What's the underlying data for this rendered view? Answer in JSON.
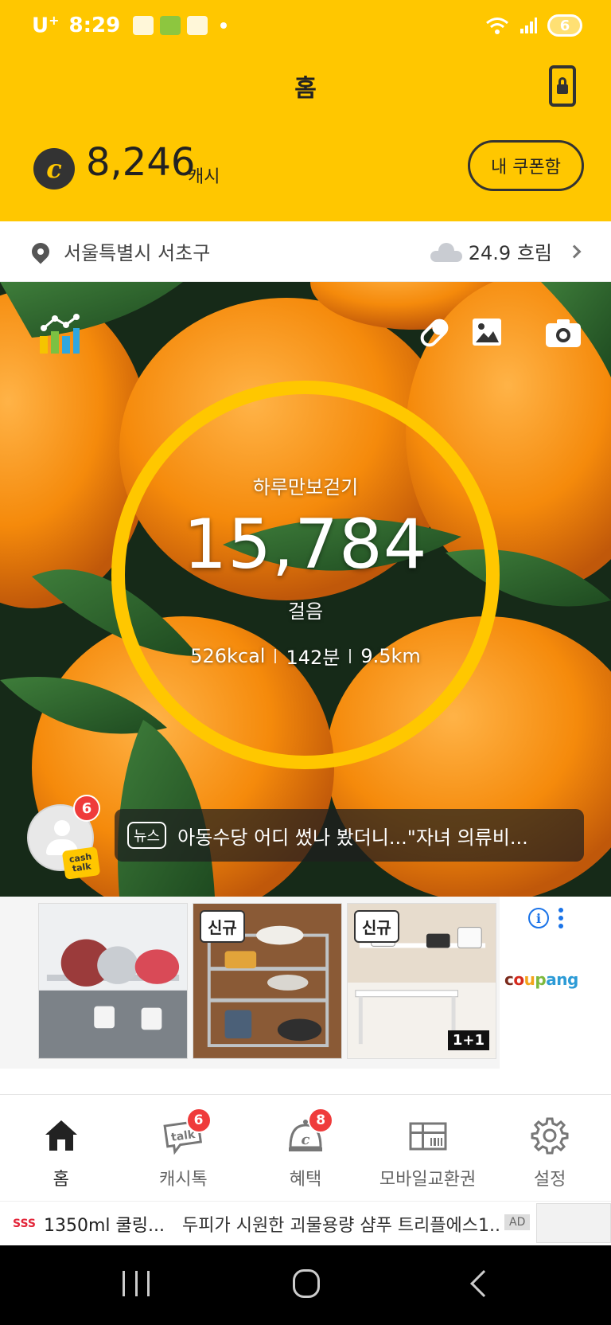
{
  "status_bar": {
    "carrier": "U",
    "carrier_sup": "+",
    "time": "8:29",
    "battery": "6"
  },
  "header": {
    "title": "홈",
    "coin_symbol": "c",
    "cash_amount": "8,246",
    "cash_unit": "캐시",
    "coupon_button": "내 쿠폰함"
  },
  "location": {
    "address": "서울특별시 서초구",
    "weather": "24.9 흐림"
  },
  "pedometer": {
    "title": "하루만보걷기",
    "steps": "15,784",
    "unit": "걸음",
    "kcal": "526kcal",
    "minutes": "142분",
    "distance": "9.5km"
  },
  "news": {
    "badge": "6",
    "tag": "뉴스",
    "headline": "아동수당 어디 썼나 봤더니...\"자녀 의류비...",
    "cashtalk_label": "cash talk"
  },
  "ad_strip": {
    "cards": [
      {
        "new_label": ""
      },
      {
        "new_label": "신규"
      },
      {
        "new_label": "신규",
        "promo": "1+1"
      }
    ],
    "info_glyph": "i",
    "brand": "coupang"
  },
  "bottom_nav": {
    "items": [
      {
        "label": "홈",
        "icon": "home-icon"
      },
      {
        "label": "캐시톡",
        "icon": "talk-icon",
        "badge": "6"
      },
      {
        "label": "혜택",
        "icon": "benefit-icon",
        "badge": "8"
      },
      {
        "label": "모바일교환권",
        "icon": "gift-voucher-icon"
      },
      {
        "label": "설정",
        "icon": "gear-icon"
      }
    ]
  },
  "bottom_ad": {
    "logo": "SSS",
    "title": "1350ml 쿨링...",
    "description": "두피가 시원한 괴물용량 샴푸 트리플에스1...",
    "ad_label": "AD"
  },
  "colors": {
    "brand_yellow": "#FFC700",
    "badge_red": "#EF3B3B",
    "info_blue": "#1A73E8"
  }
}
